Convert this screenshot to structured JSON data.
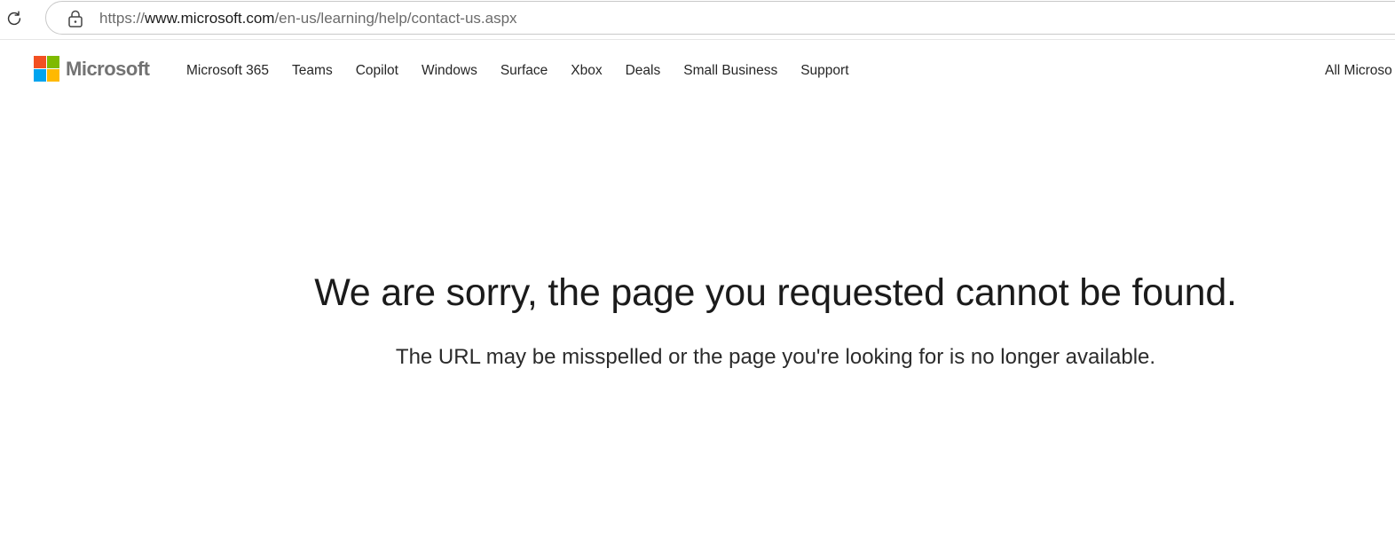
{
  "browser": {
    "url_scheme": "https://",
    "url_host": "www.microsoft.com",
    "url_path": "/en-us/learning/help/contact-us.aspx"
  },
  "header": {
    "logo_text": "Microsoft",
    "logo_colors": [
      "#f25022",
      "#7fba00",
      "#00a4ef",
      "#ffb900"
    ],
    "nav": [
      {
        "label": "Microsoft 365"
      },
      {
        "label": "Teams"
      },
      {
        "label": "Copilot"
      },
      {
        "label": "Windows"
      },
      {
        "label": "Surface"
      },
      {
        "label": "Xbox"
      },
      {
        "label": "Deals"
      },
      {
        "label": "Small Business"
      },
      {
        "label": "Support"
      }
    ],
    "all_microsoft": "All Microso"
  },
  "main": {
    "title": "We are sorry, the page you requested cannot be found.",
    "subtitle": "The URL may be misspelled or the page you're looking for is no longer available."
  }
}
